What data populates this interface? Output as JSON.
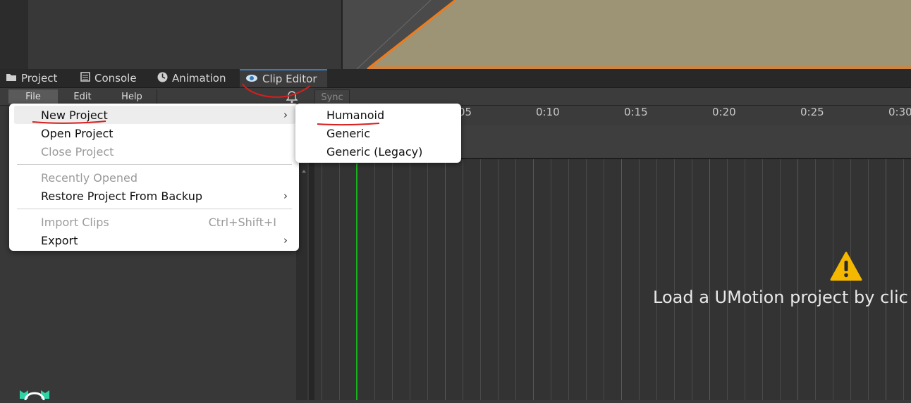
{
  "tabs": [
    {
      "label": "Project",
      "icon": "folder-icon"
    },
    {
      "label": "Console",
      "icon": "console-icon"
    },
    {
      "label": "Animation",
      "icon": "animation-clock-icon"
    },
    {
      "label": "Clip Editor",
      "icon": "eye-icon"
    }
  ],
  "toolbar": {
    "file": "File",
    "edit": "Edit",
    "help": "Help",
    "sync": "Sync"
  },
  "file_menu": {
    "new_project": "New Project",
    "open_project": "Open Project",
    "close_project": "Close Project",
    "recently_opened": "Recently Opened",
    "restore_backup": "Restore Project From Backup",
    "import_clips": "Import Clips",
    "import_shortcut": "Ctrl+Shift+I",
    "export": "Export"
  },
  "new_project_submenu": [
    "Humanoid",
    "Generic",
    "Generic (Legacy)"
  ],
  "timeline": {
    "ticks": [
      "05",
      "0:10",
      "0:15",
      "0:20",
      "0:25",
      "0:30"
    ],
    "message": "Load a UMotion project by clic"
  },
  "colors": {
    "accent_tab": "#3a79bb",
    "playhead": "#18b31c",
    "warning": "#f5b800",
    "scene_surface": "#9c9474",
    "scene_outline": "#f07b1c",
    "annotation": "#d81e1e"
  }
}
